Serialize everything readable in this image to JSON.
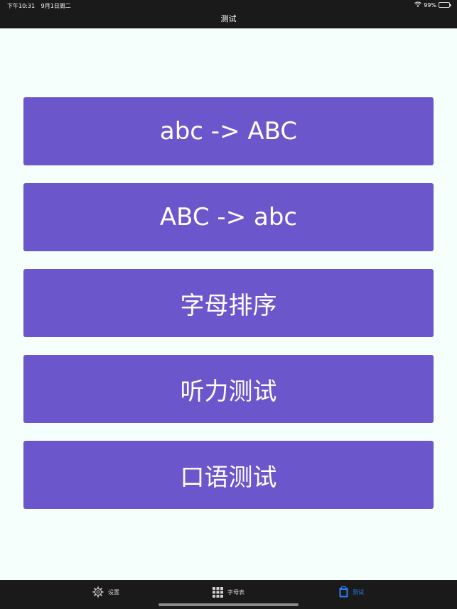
{
  "status_bar": {
    "time": "下午10:31",
    "date": "9月1日周二",
    "battery_percent": "99%",
    "battery_level": 0.99,
    "icons": [
      "wifi-icon",
      "battery-icon"
    ]
  },
  "nav": {
    "title": "测试"
  },
  "menu": {
    "buttons": [
      {
        "label": "abc -> ABC"
      },
      {
        "label": "ABC -> abc"
      },
      {
        "label": "字母排序"
      },
      {
        "label": "听力测试"
      },
      {
        "label": "口语测试"
      }
    ]
  },
  "tabbar": {
    "tabs": [
      {
        "label": "设置",
        "icon": "gear-icon",
        "active": false
      },
      {
        "label": "字母表",
        "icon": "grid-icon",
        "active": false
      },
      {
        "label": "测试",
        "icon": "clipboard-icon",
        "active": true
      }
    ]
  },
  "colors": {
    "background": "#f5fffc",
    "bars": "#1a1a1a",
    "button": "#6b56cb",
    "active_tab": "#2f7df6",
    "inactive_tab": "#cfcfcf"
  }
}
